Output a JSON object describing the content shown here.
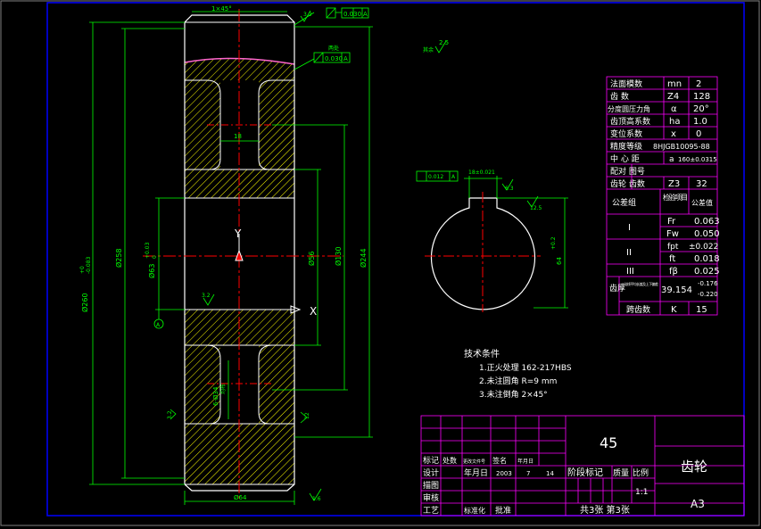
{
  "colors": {
    "background": "#000000",
    "frame": "#0000ff",
    "part": "#ffffff",
    "dimension": "#00ff00",
    "center": "#ff0000",
    "table": "#ff00ff",
    "text": "#ffffff",
    "hatch": "#ffff00",
    "section": "#ff66cc"
  },
  "dims": {
    "chamfer_top": "1×45°",
    "d_outer": "Ø260",
    "d_outer_tol_upper": "+0",
    "d_outer_tol_lower": "-0.083",
    "d_258": "Ø258",
    "d_bore": "Ø63",
    "d_bore_tol_upper": "+0.03",
    "d_bore_tol_lower": "0",
    "d_56": "Ø56",
    "d_130": "Ø130",
    "d_244": "Ø244",
    "width_18": "18",
    "d_bottom": "Ø64",
    "holes": "6-Ø34",
    "holes_sub": "均布",
    "gdt_tol_1": "0.030",
    "gdt_ref_1": "A",
    "gdt_tol_2": "0.030",
    "gdt_ref_2": "A",
    "gdt_note": "两处",
    "rough_top": "3.2",
    "rough_web": "3.2",
    "rough_left": "3.2",
    "rough_right": "12",
    "rough_bottom": "1.6",
    "rest_label": "其余",
    "rest_value": "2.5",
    "axis_y": "Y",
    "axis_x": "X",
    "datum_a": "A"
  },
  "keyway": {
    "width": "18±0.021",
    "gdt_tol": "0.012",
    "gdt_ref": "A",
    "rough_1": "6.3",
    "rough_2": "12.5",
    "depth": "64",
    "depth_tol": "+0.2"
  },
  "params": [
    {
      "label": "法面模数",
      "sym": "mn",
      "val": "2"
    },
    {
      "label": "齿      数",
      "sym": "Z4",
      "val": "128"
    },
    {
      "label": "分度圆压力角",
      "sym": "α",
      "val": "20°"
    },
    {
      "label": "齿顶高系数",
      "sym": "ha",
      "val": "1.0"
    },
    {
      "label": "变位系数",
      "sym": "x",
      "val": "0"
    },
    {
      "label": "精度等级",
      "sym": "",
      "val": "8HJGB10095-88"
    },
    {
      "label": "中  心  距",
      "sym": "a",
      "val": "160±0.0315"
    },
    {
      "label": "配对 图号",
      "sym": "",
      "val": ""
    },
    {
      "label": "齿轮 齿数",
      "sym": "Z3",
      "val": "32"
    }
  ],
  "tolerance_table": {
    "head_group": "公差组",
    "head_item": "检验项目",
    "head_value": "公差值",
    "group_1": "I",
    "group_2": "II",
    "group_3": "III",
    "rows": [
      {
        "sym": "Fr",
        "val": "0.063"
      },
      {
        "sym": "Fw",
        "val": "0.050"
      },
      {
        "sym": "fpt",
        "val": "±0.022"
      },
      {
        "sym": "ft",
        "val": "0.018"
      },
      {
        "sym": "fβ",
        "val": "0.025"
      }
    ],
    "thick_label": "齿厚",
    "thick_desc": "公法线平均长度及上下偏差",
    "thick_val": "39.154",
    "thick_upper": "-0.176",
    "thick_lower": "-0.220",
    "span_label": "跨齿数",
    "span_sym": "K",
    "span_val": "15"
  },
  "notes": {
    "title": "技术条件",
    "items": [
      "1.正火处理 162-217HBS",
      "2.未注圆角 R=9 mm",
      "3.未注倒角 2×45°"
    ]
  },
  "title_block": {
    "material": "45",
    "part_name": "齿轮",
    "mark": "标记",
    "count": "处数",
    "file_no": "更改文件号",
    "sign": "签名",
    "date_label": "年月日",
    "design": "设计",
    "draw": "描图",
    "check": "审核",
    "craft": "工艺",
    "year": "年月日",
    "y1": "2003",
    "m1": "7",
    "d1": "14",
    "stage": "阶段标记",
    "weight": "质量",
    "ratio_label": "比例",
    "ratio_val": "1:1",
    "standard": "标准化",
    "approve": "批准",
    "sheets": "共3张  第3张",
    "size": "A3"
  }
}
